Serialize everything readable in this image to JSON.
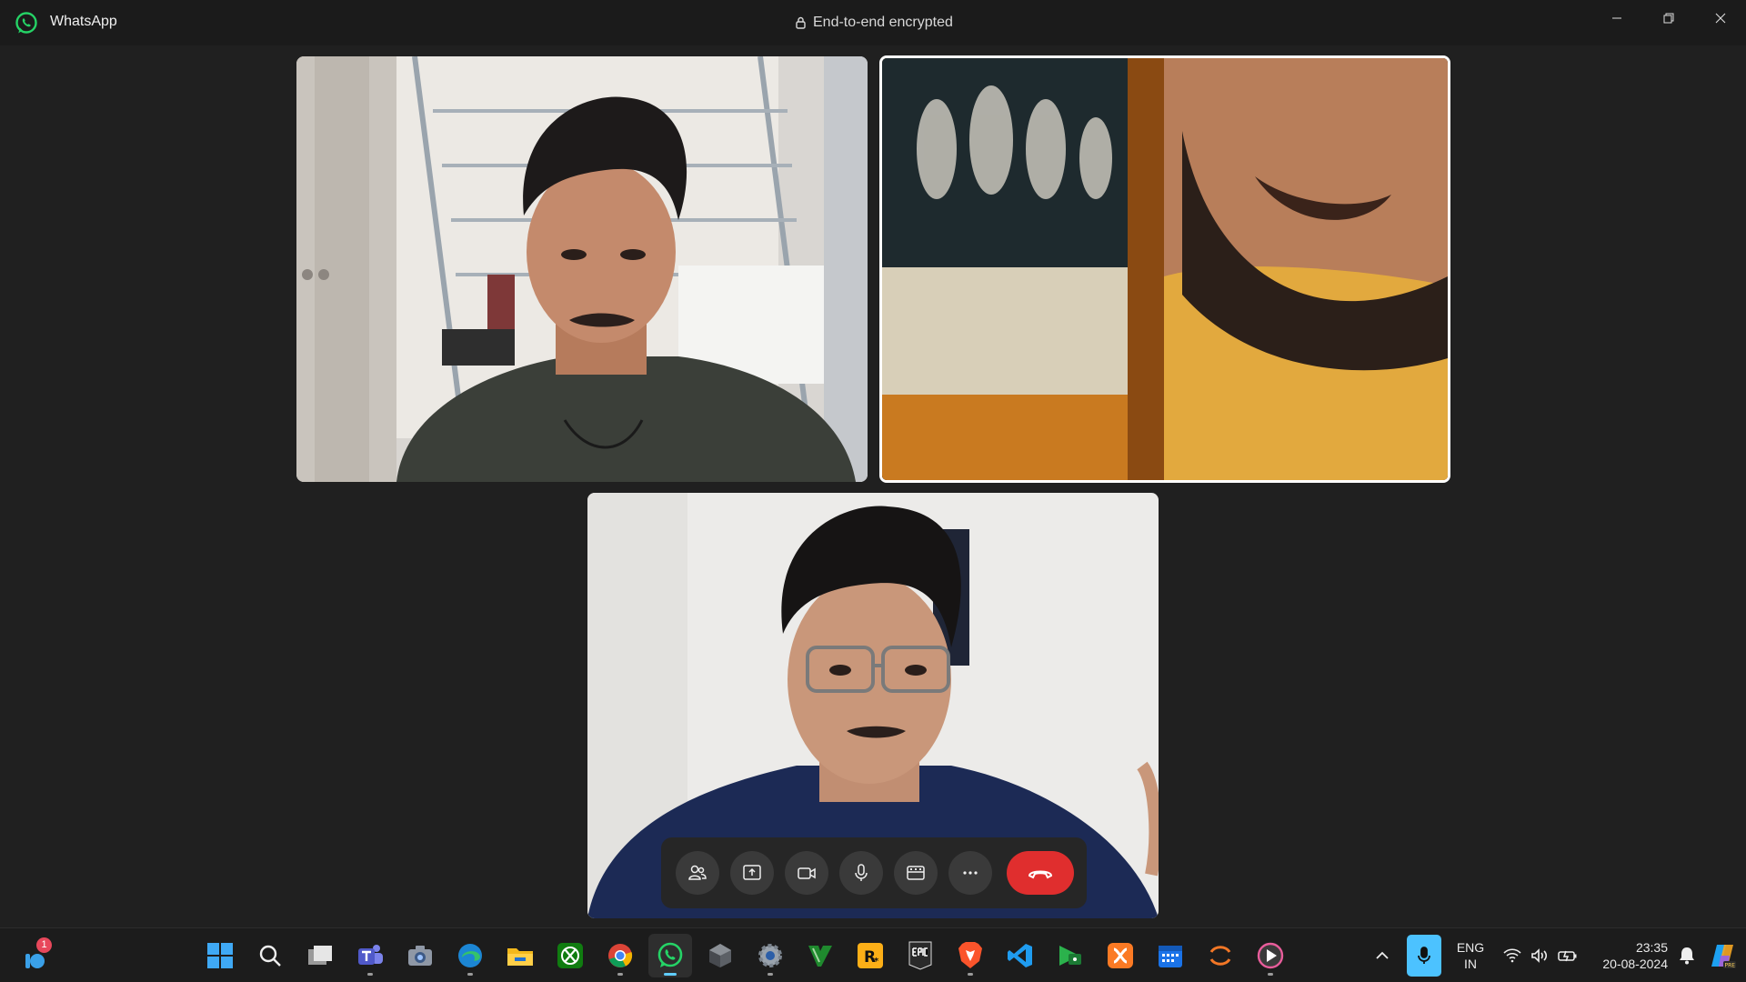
{
  "window": {
    "app_name": "WhatsApp",
    "encryption_label": "End-to-end encrypted",
    "brand_color": "#25D366"
  },
  "call": {
    "participants": [
      {
        "tile": "participant-1"
      },
      {
        "tile": "participant-2",
        "active_speaker": true
      },
      {
        "tile": "self-view"
      }
    ],
    "controls": [
      {
        "name": "participants-icon"
      },
      {
        "name": "share-screen-icon"
      },
      {
        "name": "camera-icon"
      },
      {
        "name": "microphone-icon"
      },
      {
        "name": "layout-icon"
      },
      {
        "name": "more-options-icon"
      },
      {
        "name": "end-call-icon",
        "color": "#E02E2E"
      }
    ]
  },
  "taskbar": {
    "widget_badge": "1",
    "apps": [
      {
        "name": "start-icon"
      },
      {
        "name": "search-icon"
      },
      {
        "name": "task-view-icon"
      },
      {
        "name": "teams-icon"
      },
      {
        "name": "camera-app-icon"
      },
      {
        "name": "edge-icon"
      },
      {
        "name": "file-explorer-icon"
      },
      {
        "name": "xbox-icon"
      },
      {
        "name": "chrome-icon"
      },
      {
        "name": "whatsapp-icon",
        "active": true
      },
      {
        "name": "cube-app-icon"
      },
      {
        "name": "settings-icon"
      },
      {
        "name": "vim-icon"
      },
      {
        "name": "rockstar-icon"
      },
      {
        "name": "epic-games-icon"
      },
      {
        "name": "brave-icon"
      },
      {
        "name": "vscode-icon"
      },
      {
        "name": "games-store-icon"
      },
      {
        "name": "xampp-icon"
      },
      {
        "name": "calendar-icon"
      },
      {
        "name": "jupyter-icon"
      },
      {
        "name": "media-player-icon"
      }
    ],
    "language_line1": "ENG",
    "language_line2": "IN",
    "time": "23:35",
    "date": "20-08-2024"
  }
}
